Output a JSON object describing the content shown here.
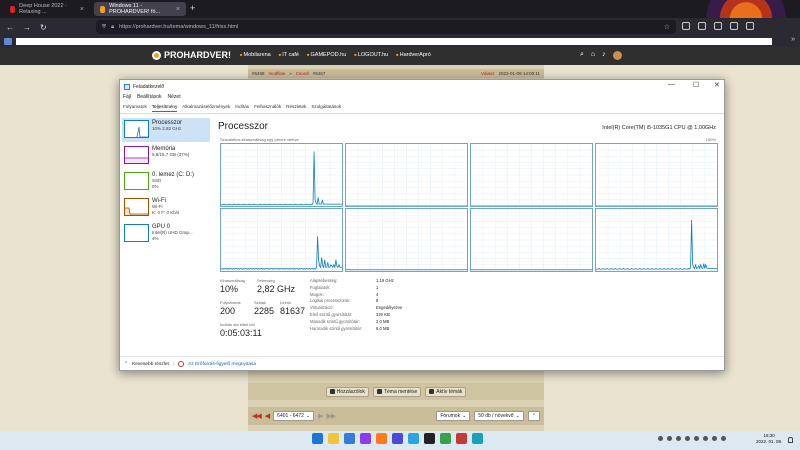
{
  "browser": {
    "tabs": [
      {
        "title": "Deep House 2022 · Relaxing ...",
        "favicon_color": "#e62117",
        "active": false
      },
      {
        "title": "Windows 11 - PROHARDVER! fó...",
        "favicon_color": "#f0a020",
        "active": true
      }
    ],
    "new_tab": "+",
    "url": "https://prohardver.hu/tema/windows_11/friss.html"
  },
  "site": {
    "logo": "PROHARDVER!",
    "links": [
      "Mobilarena",
      "IT café",
      "GAMEPOD.hu",
      "LOGOUT.hu",
      "HardverApró"
    ],
    "thread": {
      "msg": "#6468",
      "author": "modflow",
      "to": "Csordi",
      "reply_to": "#6467",
      "reply": "Válasz",
      "date": "2022-01-08 14:00:11"
    },
    "actions": [
      "Hozzászólok",
      "Téma mentése",
      "Aktív témák"
    ],
    "pager": {
      "range": "6401 - 6472",
      "forum": "Fórumok",
      "sort": "50 db / növekvő"
    }
  },
  "taskmgr": {
    "title": "Feladatkezelő",
    "controls": {
      "minimize": "—",
      "maximize": "☐",
      "close": "✕"
    },
    "menu": [
      "Fájl",
      "Beállítások",
      "Nézet"
    ],
    "tabs": [
      "Folyamatok",
      "Teljesítmény",
      "Alkalmazáselőzmények",
      "Indítás",
      "Felhasználók",
      "Részletek",
      "Szolgáltatások"
    ],
    "active_tab": "Teljesítmény",
    "side": [
      {
        "title": "Processzor",
        "sub1": "10% 2,82 GHz",
        "sub2": "",
        "border": "#117dbb",
        "active": true
      },
      {
        "title": "Memória",
        "sub1": "5,8/15,7 GB (37%)",
        "sub2": "",
        "border": "#8b12ae",
        "active": false
      },
      {
        "title": "0. lemez (C: D:)",
        "sub1": "SSD",
        "sub2": "0%",
        "border": "#4da60c",
        "active": false
      },
      {
        "title": "Wi-Fi",
        "sub1": "Wi-Fi",
        "sub2": "K: 0 F: 0 Kb/s",
        "border": "#a74f01",
        "active": false
      },
      {
        "title": "GPU 0",
        "sub1": "Intel(R) UHD Grap...",
        "sub2": "4%",
        "border": "#117dbb",
        "active": false
      }
    ],
    "heading": "Processzor",
    "cpu_name": "Intel(R) Core(TM) i5-1035G1 CPU @ 1,00GHz",
    "graph_label": "Százalékos kihasználtság egy percre vetítve",
    "graph_max": "100%",
    "core_graphs": [
      [
        2,
        2,
        2,
        3,
        2,
        2,
        2,
        2,
        3,
        2,
        2,
        2,
        2,
        3,
        2,
        2,
        2,
        3,
        2,
        2,
        2,
        2,
        3,
        2,
        2,
        2,
        2,
        3,
        2,
        2,
        2,
        2,
        3,
        2,
        2,
        2,
        2,
        2,
        3,
        2,
        2,
        2,
        3,
        2,
        2,
        2,
        2,
        3,
        2,
        2,
        2,
        2,
        3,
        2,
        2,
        2,
        2,
        3,
        2,
        2,
        2,
        2,
        3,
        2,
        2,
        2,
        2,
        3,
        2,
        2,
        2,
        2,
        3,
        2,
        2,
        2,
        2,
        3,
        2,
        2,
        2,
        2,
        3,
        2,
        2,
        2,
        2,
        3,
        2,
        5,
        88,
        10,
        5,
        3,
        14,
        3,
        3,
        3,
        10,
        3,
        3,
        3,
        3,
        3,
        3,
        3,
        3,
        3,
        3,
        3,
        3,
        3,
        3,
        3,
        3,
        3,
        3,
        3
      ],
      [
        0,
        0,
        0,
        0,
        0,
        0,
        0,
        0,
        0,
        0,
        0,
        0,
        0,
        0,
        0,
        0,
        0,
        0,
        0,
        0,
        0,
        0,
        0,
        0,
        0,
        0,
        0,
        0,
        0,
        0,
        0,
        0,
        0,
        0,
        0,
        0,
        0,
        0,
        0,
        0,
        0,
        0,
        0,
        0,
        0,
        0,
        0,
        0,
        0,
        0,
        0,
        0,
        0,
        0,
        0,
        0,
        0,
        0,
        0,
        0,
        0,
        0,
        0,
        0,
        0,
        0,
        0,
        0,
        0,
        0,
        0,
        0,
        0,
        0,
        0,
        0,
        0,
        0,
        0,
        0,
        0,
        0,
        0,
        0,
        0,
        0,
        0,
        0,
        0,
        0,
        0,
        0,
        0,
        0,
        0,
        0,
        0,
        0,
        0,
        0,
        0,
        0,
        0,
        0,
        0,
        0,
        0,
        0,
        0,
        0,
        0,
        0,
        0,
        0,
        0,
        0,
        0
      ],
      [
        0,
        0,
        0,
        0,
        0,
        0,
        0,
        0,
        0,
        0,
        0,
        0,
        0,
        0,
        0,
        0,
        0,
        0,
        0,
        0,
        0,
        0,
        0,
        0,
        0,
        0,
        0,
        0,
        0,
        0,
        0,
        0,
        0,
        0,
        0,
        0,
        0,
        0,
        0,
        0,
        0,
        0,
        0,
        0,
        0,
        0,
        0,
        0,
        0,
        0,
        0,
        0,
        0,
        0,
        0,
        0,
        0,
        0,
        0,
        0,
        0,
        0,
        0,
        0,
        0,
        0,
        0,
        0,
        0,
        0,
        0,
        0,
        0,
        0,
        0,
        0,
        0,
        0,
        0,
        0,
        0,
        0,
        0,
        0,
        0,
        0,
        0,
        0,
        0,
        0,
        0,
        0,
        0,
        0,
        0,
        0,
        0,
        0,
        0,
        0,
        0,
        0,
        0,
        0,
        0,
        0,
        0,
        0,
        0,
        0,
        0,
        0,
        0,
        0,
        0,
        0,
        0
      ],
      [
        0,
        0,
        0,
        0,
        0,
        0,
        0,
        0,
        0,
        0,
        0,
        0,
        0,
        0,
        0,
        0,
        0,
        0,
        0,
        0,
        0,
        0,
        0,
        0,
        0,
        0,
        0,
        0,
        0,
        0,
        0,
        0,
        0,
        0,
        0,
        0,
        0,
        0,
        0,
        0,
        0,
        0,
        0,
        0,
        0,
        0,
        0,
        0,
        0,
        0,
        0,
        0,
        0,
        0,
        0,
        0,
        0,
        0,
        0,
        0,
        0,
        0,
        0,
        0,
        0,
        0,
        0,
        0,
        0,
        0,
        0,
        0,
        0,
        0,
        0,
        0,
        0,
        0,
        0,
        0,
        0,
        0,
        0,
        0,
        0,
        0,
        0,
        0,
        0,
        0,
        0,
        0,
        0,
        0,
        0,
        0,
        0,
        0,
        0,
        0,
        0,
        0,
        0,
        0,
        0,
        0,
        0,
        0,
        0,
        0,
        0,
        0,
        0,
        0,
        0,
        0,
        0
      ],
      [
        4,
        3,
        4,
        3,
        4,
        4,
        3,
        4,
        3,
        4,
        4,
        3,
        4,
        3,
        4,
        4,
        3,
        4,
        3,
        4,
        4,
        3,
        4,
        3,
        4,
        4,
        3,
        4,
        3,
        4,
        4,
        3,
        4,
        3,
        4,
        4,
        3,
        4,
        3,
        4,
        4,
        3,
        4,
        3,
        4,
        4,
        3,
        4,
        3,
        4,
        4,
        3,
        4,
        3,
        4,
        4,
        3,
        4,
        3,
        4,
        4,
        3,
        4,
        3,
        4,
        4,
        3,
        4,
        3,
        4,
        4,
        3,
        4,
        3,
        4,
        4,
        3,
        4,
        3,
        4,
        4,
        3,
        4,
        3,
        4,
        4,
        3,
        4,
        3,
        4,
        4,
        3,
        4,
        3,
        6,
        56,
        18,
        8,
        6,
        22,
        8,
        6,
        18,
        6,
        6,
        14,
        6,
        6,
        10,
        8,
        6,
        10,
        6,
        18,
        8,
        6,
        10,
        6,
        6,
        6
      ],
      [
        2,
        2,
        2,
        2,
        2,
        2,
        2,
        2,
        2,
        2,
        2,
        2,
        2,
        2,
        2,
        2,
        2,
        2,
        2,
        2,
        2,
        2,
        2,
        2,
        2,
        2,
        2,
        2,
        2,
        2,
        2,
        2,
        2,
        2,
        2,
        2,
        2,
        2,
        2,
        2,
        2,
        2,
        2,
        2,
        2,
        2,
        2,
        2,
        2,
        2,
        2,
        2,
        2,
        2,
        2,
        2,
        2,
        2,
        2,
        2,
        2,
        2,
        2,
        2,
        2,
        2,
        2,
        2,
        2,
        2,
        2,
        2,
        2,
        2,
        2,
        2,
        2,
        2,
        2,
        2,
        2,
        2,
        2,
        2,
        2,
        2,
        2,
        2,
        2,
        2,
        2,
        2,
        2,
        2,
        2,
        2,
        2,
        2,
        2,
        2,
        2,
        2,
        2,
        2,
        2,
        2,
        2,
        2,
        2,
        2,
        2,
        2,
        2,
        2,
        2,
        2,
        2
      ],
      [
        2,
        2,
        2,
        2,
        2,
        2,
        2,
        2,
        2,
        2,
        2,
        2,
        2,
        2,
        2,
        2,
        2,
        2,
        2,
        2,
        2,
        2,
        2,
        2,
        2,
        2,
        2,
        2,
        2,
        2,
        2,
        2,
        2,
        2,
        2,
        2,
        2,
        2,
        2,
        2,
        2,
        2,
        2,
        2,
        2,
        2,
        2,
        2,
        2,
        2,
        2,
        2,
        2,
        2,
        2,
        2,
        2,
        2,
        2,
        2,
        2,
        2,
        2,
        2,
        2,
        2,
        2,
        2,
        2,
        2,
        2,
        2,
        2,
        2,
        2,
        2,
        2,
        2,
        2,
        2,
        2,
        2,
        2,
        2,
        2,
        2,
        2,
        2,
        2,
        2,
        2,
        2,
        2,
        2,
        2,
        2,
        2,
        2,
        2,
        2,
        2,
        2,
        2,
        2,
        2,
        2,
        2,
        2,
        2,
        2,
        2,
        2,
        2,
        2,
        2,
        2,
        2
      ],
      [
        3,
        3,
        3,
        4,
        3,
        3,
        3,
        4,
        3,
        3,
        3,
        4,
        3,
        3,
        3,
        4,
        3,
        3,
        3,
        4,
        3,
        3,
        3,
        4,
        3,
        3,
        3,
        4,
        3,
        3,
        3,
        4,
        3,
        3,
        3,
        4,
        3,
        3,
        3,
        4,
        3,
        3,
        3,
        4,
        3,
        3,
        3,
        4,
        3,
        3,
        3,
        4,
        3,
        3,
        3,
        4,
        3,
        3,
        3,
        4,
        3,
        3,
        3,
        4,
        3,
        3,
        3,
        4,
        3,
        3,
        3,
        4,
        3,
        3,
        3,
        4,
        3,
        3,
        3,
        4,
        3,
        3,
        3,
        4,
        3,
        3,
        3,
        4,
        3,
        3,
        3,
        4,
        3,
        5,
        82,
        12,
        6,
        4,
        10,
        4,
        5,
        8,
        4,
        10,
        5,
        4,
        12,
        4,
        10,
        5,
        4,
        4,
        4,
        4,
        4,
        4,
        4,
        4,
        4,
        4
      ]
    ],
    "stats": {
      "util_label": "Kihasználtság",
      "util": "10%",
      "speed_label": "Sebesség",
      "speed": "2,82 GHz",
      "proc_label": "Folyamatok",
      "proc": "200",
      "threads_label": "Szálak",
      "threads": "2285",
      "handles_label": "Leírók",
      "handles": "81637",
      "uptime_label": "Indítás óta eltelt idő",
      "uptime": "0:05:03:11"
    },
    "details": [
      {
        "k": "Alapsebesség:",
        "v": "1,19 GHz"
      },
      {
        "k": "Foglalatok:",
        "v": "1"
      },
      {
        "k": "Magok:",
        "v": "4"
      },
      {
        "k": "Logikai processzorok:",
        "v": "8"
      },
      {
        "k": "Virtualizáció:",
        "v": "Engedélyezve"
      },
      {
        "k": "Első szintű gyorsítótár:",
        "v": "320 KB"
      },
      {
        "k": "Második szintű gyorsítótár:",
        "v": "2,0 MB"
      },
      {
        "k": "Harmadik szintű gyorsítótár:",
        "v": "6,0 MB"
      }
    ],
    "footer_less": "Kevesebb részlet",
    "footer_link": "Az Erőforrás-figyelő megnyitása"
  },
  "taskbar": {
    "apps": [
      "#1f74d6",
      "#f3c43a",
      "#3a7bd5",
      "#8a3ef0",
      "#ff7b1a",
      "#4a4ad8",
      "#2aa5e0",
      "#222222",
      "#3aa14b",
      "#c33a3a",
      "#1aa0ba"
    ],
    "time": "18:30",
    "date": "2022. 01. 08."
  }
}
